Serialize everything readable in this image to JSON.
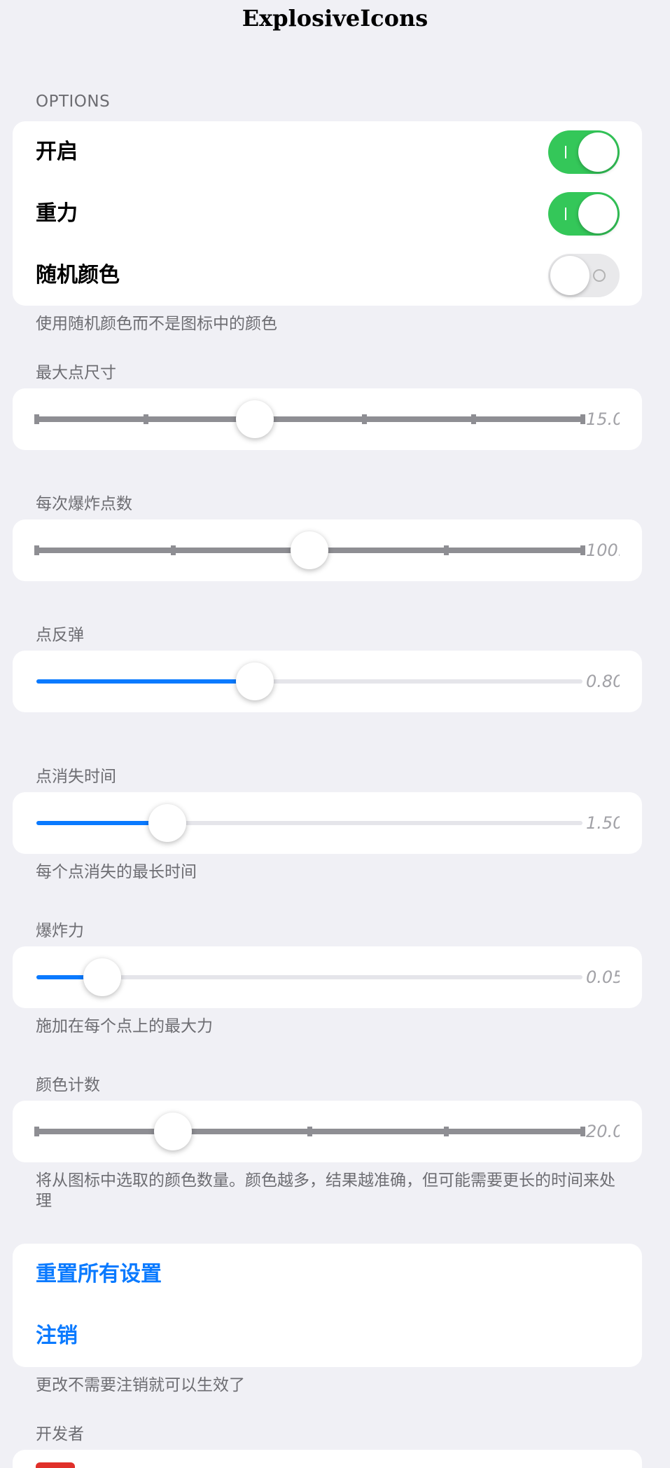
{
  "nav": {
    "title": "ExplosiveIcons"
  },
  "options": {
    "header": "OPTIONS",
    "rows": [
      {
        "label": "开启",
        "on": true
      },
      {
        "label": "重力",
        "on": true
      },
      {
        "label": "随机颜色",
        "on": false
      }
    ],
    "footer": "使用随机颜色而不是图标中的颜色"
  },
  "sliders": [
    {
      "header": "最大点尺寸",
      "value_text": "15.0",
      "fraction": 0.4,
      "stepped": true,
      "ticks": 6
    },
    {
      "header": "每次爆炸点数",
      "value_text": "100.",
      "fraction": 0.5,
      "stepped": true,
      "ticks": 5
    },
    {
      "header": "点反弹",
      "value_text": "0.80",
      "fraction": 0.4,
      "stepped": false
    },
    {
      "header": "点消失时间",
      "value_text": "1.50",
      "fraction": 0.24,
      "stepped": false,
      "footer": "每个点消失的最长时间"
    },
    {
      "header": "爆炸力",
      "value_text": "0.05",
      "fraction": 0.12,
      "stepped": false,
      "footer": "施加在每个点上的最大力"
    },
    {
      "header": "颜色计数",
      "value_text": "20.0",
      "fraction": 0.25,
      "stepped": true,
      "ticks": 5,
      "footer": "将从图标中选取的颜色数量。颜色越多，结果越准确，但可能需要更长的时间来处理"
    }
  ],
  "actions": {
    "reset_label": "重置所有设置",
    "respring_label": "注销",
    "footer": "更改不需要注销就可以生效了"
  },
  "developer": {
    "header": "开发者"
  },
  "colors": {
    "accent": "#0a7aff",
    "switch_on": "#34c759",
    "background": "#f0f0f5"
  }
}
